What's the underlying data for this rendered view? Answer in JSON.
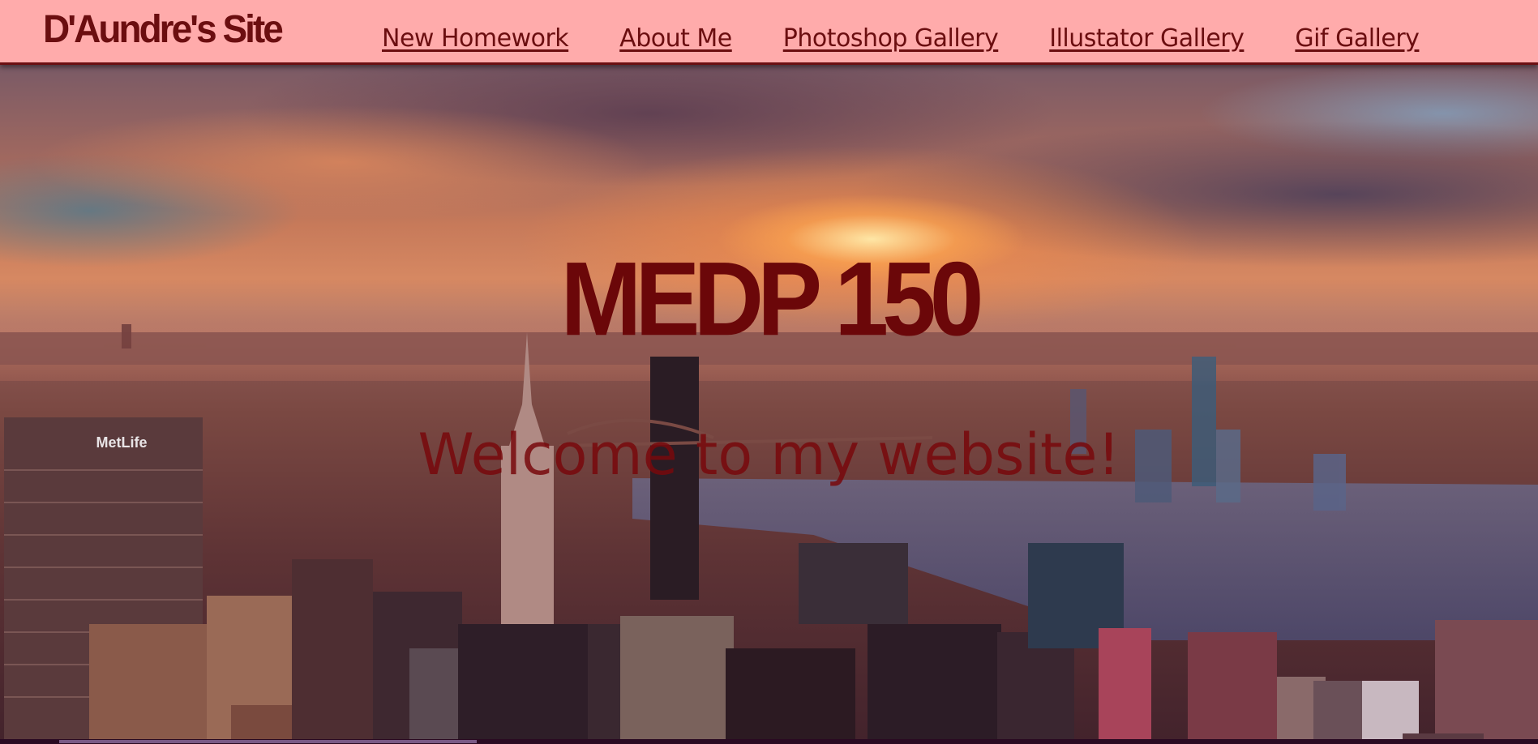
{
  "navbar": {
    "brand": "D'Aundre's Site",
    "links": [
      {
        "label": "New Homework"
      },
      {
        "label": "About Me"
      },
      {
        "label": "Photoshop Gallery"
      },
      {
        "label": "Illustator Gallery"
      },
      {
        "label": "Gif Gallery"
      }
    ]
  },
  "hero": {
    "title": "MEDP 150",
    "subtitle": "Welcome to my website!",
    "building_sign": "MetLife"
  },
  "colors": {
    "navbar_bg": "#ffabab",
    "accent": "#6b0e10"
  }
}
